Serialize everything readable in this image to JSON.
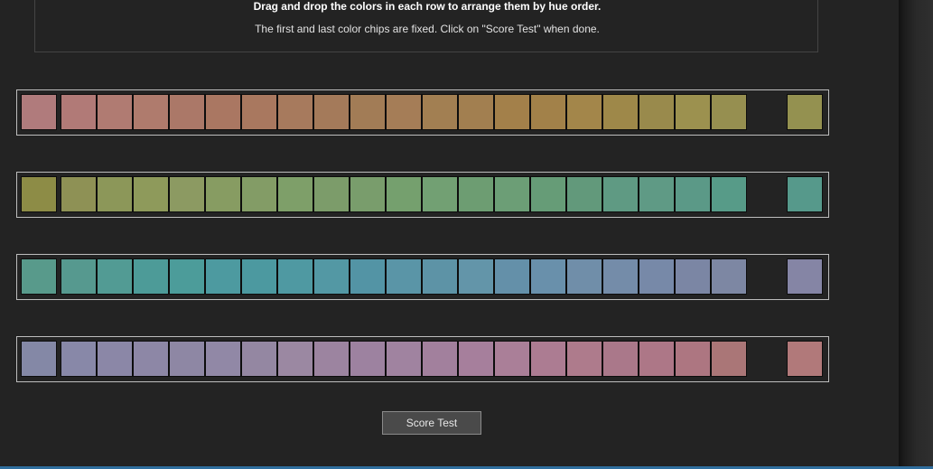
{
  "instructions": {
    "title": "Drag and drop the colors in each row to arrange them by hue order.",
    "subtitle": "The first and last color chips are fixed. Click on \"Score Test\" when done."
  },
  "rows": [
    {
      "name": "row-1",
      "chips": [
        "#b07b7c",
        "#b17a77",
        "#b07b72",
        "#af7b6d",
        "#ab7868",
        "#aa7762",
        "#a9785f",
        "#a77a5d",
        "#a47a5a",
        "#a27c56",
        "#a57d57",
        "#a27f52",
        "#a27f50",
        "#a3804a",
        "#a28149",
        "#a3864a",
        "#9e8849",
        "#998a4c",
        "#9c914f",
        "#968f50",
        "#949150"
      ],
      "fixed": [
        true,
        false,
        false,
        false,
        false,
        false,
        false,
        false,
        false,
        false,
        false,
        false,
        false,
        false,
        false,
        false,
        false,
        false,
        false,
        false,
        true
      ]
    },
    {
      "name": "row-2",
      "chips": [
        "#8d8c46",
        "#8e9155",
        "#8c9759",
        "#8e9a5b",
        "#8c9a62",
        "#879c62",
        "#839c66",
        "#7e9f69",
        "#7c9c6a",
        "#799d6c",
        "#75a06e",
        "#72a073",
        "#6d9d72",
        "#6c9e76",
        "#669c77",
        "#62997b",
        "#5f9a83",
        "#5f9a85",
        "#5b9987",
        "#579b88",
        "#56998b"
      ],
      "fixed": [
        true,
        false,
        false,
        false,
        false,
        false,
        false,
        false,
        false,
        false,
        false,
        false,
        false,
        false,
        false,
        false,
        false,
        false,
        false,
        false,
        true
      ]
    },
    {
      "name": "row-3",
      "chips": [
        "#589a8b",
        "#56998f",
        "#529b94",
        "#4d9b98",
        "#4c9c9a",
        "#4d9aa0",
        "#4c99a0",
        "#4f99a2",
        "#5398a4",
        "#5394a5",
        "#5a95a7",
        "#5d93a6",
        "#6395a9",
        "#6490a9",
        "#6990ab",
        "#708ea9",
        "#748ca9",
        "#7789a8",
        "#7b86a4",
        "#7d87a3",
        "#8585a5"
      ],
      "fixed": [
        true,
        false,
        false,
        false,
        false,
        false,
        false,
        false,
        false,
        false,
        false,
        false,
        false,
        false,
        false,
        false,
        false,
        false,
        false,
        false,
        true
      ]
    },
    {
      "name": "row-4",
      "chips": [
        "#8488a6",
        "#8888a8",
        "#8b87a7",
        "#8d87a6",
        "#8e87a4",
        "#9188a6",
        "#9487a2",
        "#9b88a2",
        "#9c84a0",
        "#9d82a0",
        "#a083a0",
        "#a2809d",
        "#a67f9c",
        "#aa7f98",
        "#ac7c92",
        "#ae7b8c",
        "#aa788a",
        "#ad7787",
        "#ad7681",
        "#aa7677",
        "#b1797a"
      ],
      "fixed": [
        true,
        false,
        false,
        false,
        false,
        false,
        false,
        false,
        false,
        false,
        false,
        false,
        false,
        false,
        false,
        false,
        false,
        false,
        false,
        false,
        true
      ]
    }
  ],
  "score_button": {
    "label": "Score Test"
  }
}
